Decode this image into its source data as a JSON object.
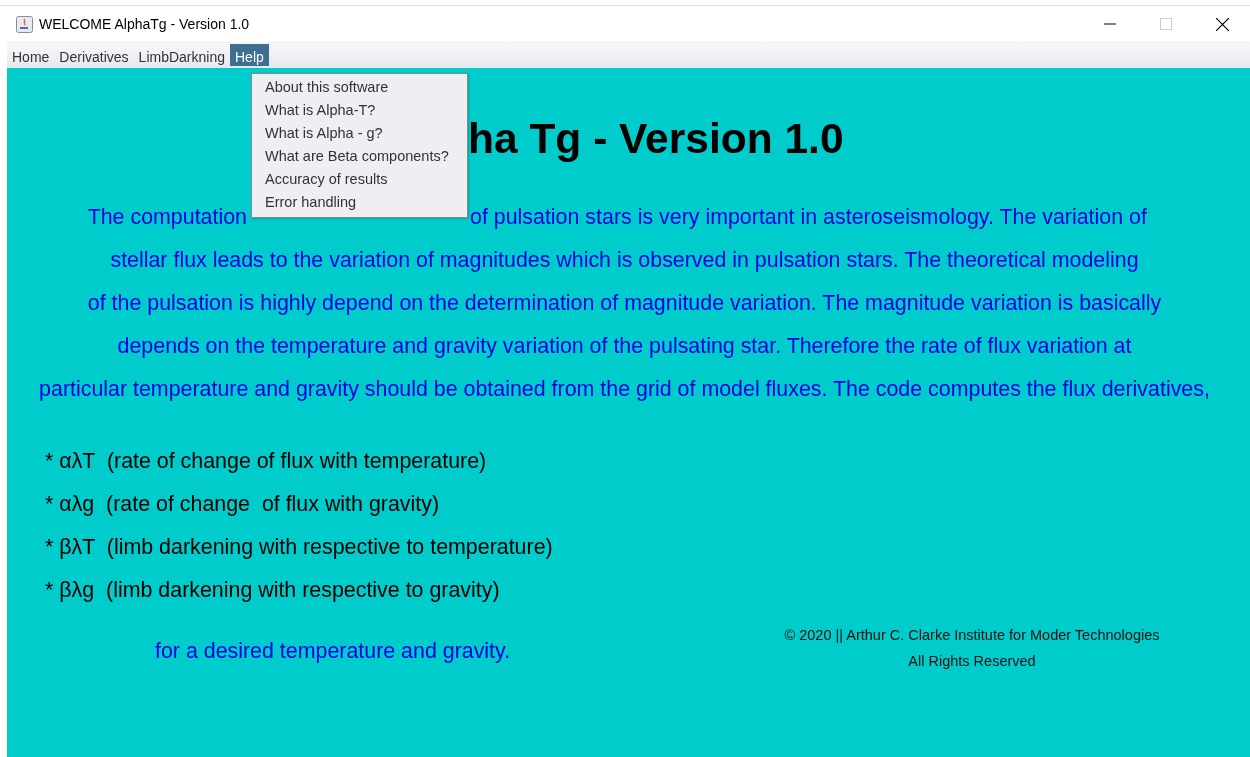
{
  "window": {
    "title": "WELCOME AlphaTg - Version 1.0"
  },
  "menu_bar": [
    {
      "label": "Home",
      "selected": false
    },
    {
      "label": "Derivatives",
      "selected": false
    },
    {
      "label": "LimbDarkning",
      "selected": false
    },
    {
      "label": "Help",
      "selected": true
    }
  ],
  "open_menu": {
    "items": [
      "About this software",
      "What is Alpha-T?",
      "What is Alpha - g?",
      "What are Beta components?",
      "Accuracy of results",
      "Error handling"
    ]
  },
  "heading": "ha Tg - Version 1.0",
  "paragraph_lines": [
    {
      "parts": [
        "The computation",
        "of pulsation stars is very important in asteroseismology. The variation of"
      ]
    },
    {
      "parts": [
        "stellar flux leads to the variation of magnitudes which is observed in pulsation stars. The theoretical modeling"
      ]
    },
    {
      "parts": [
        "of the pulsation is highly depend on the determination of magnitude variation. The magnitude variation is basically"
      ]
    },
    {
      "parts": [
        "depends on the temperature and gravity variation of the pulsating star. Therefore the rate of flux variation at"
      ]
    },
    {
      "parts": [
        "particular temperature and gravity should be obtained from the grid of model fluxes. The code computes the flux derivatives,"
      ]
    }
  ],
  "bullets": [
    "* αλT  (rate of change of flux with temperature)",
    "* αλg  (rate of change  of flux with gravity)",
    "* βλT  (limb darkening with respective to temperature)",
    "* βλg  (limb darkening with respective to gravity)"
  ],
  "closing_line": "for a desired temperature and gravity.",
  "copyright": [
    "© 2020 || Arthur C. Clarke Institute for Moder Technologies",
    "All Rights Reserved"
  ]
}
